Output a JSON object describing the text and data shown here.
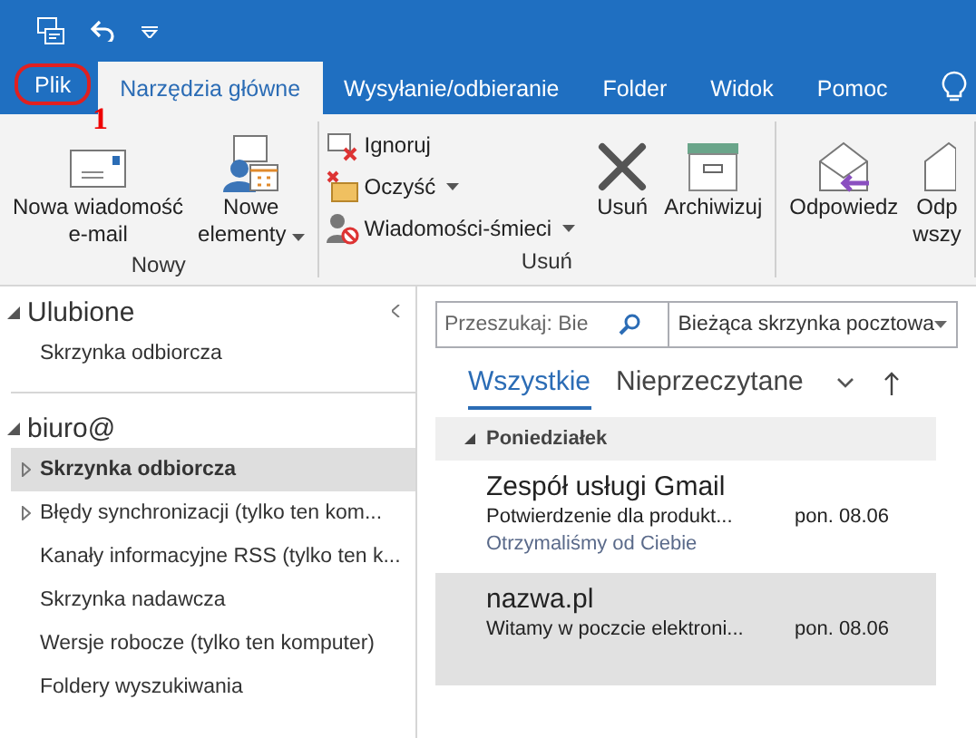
{
  "tabs": [
    {
      "label": "Plik",
      "selected": false,
      "kind": "file",
      "highlighted": true,
      "marker": "1"
    },
    {
      "label": "Narzędzia główne",
      "selected": true,
      "kind": "tab"
    },
    {
      "label": "Wysyłanie/odbieranie",
      "selected": false,
      "kind": "tab"
    },
    {
      "label": "Folder",
      "selected": false,
      "kind": "tab"
    },
    {
      "label": "Widok",
      "selected": false,
      "kind": "tab"
    },
    {
      "label": "Pomoc",
      "selected": false,
      "kind": "tab"
    }
  ],
  "ribbon": {
    "groups": [
      {
        "label": "Nowy",
        "buttons": [
          {
            "kind": "large",
            "lines": [
              "Nowa wiadomość",
              "e-mail"
            ],
            "dropdown": false
          },
          {
            "kind": "large",
            "lines": [
              "Nowe",
              "elementy"
            ],
            "dropdown": true
          }
        ]
      },
      {
        "label": "Usuń",
        "buttons": [
          {
            "kind": "small",
            "lines": [
              "Ignoruj"
            ],
            "dropdown": false
          },
          {
            "kind": "small",
            "lines": [
              "Oczyść"
            ],
            "dropdown": true
          },
          {
            "kind": "small",
            "lines": [
              "Wiadomości-śmieci"
            ],
            "dropdown": true
          },
          {
            "kind": "large",
            "lines": [
              "Usuń"
            ],
            "dropdown": false
          },
          {
            "kind": "large",
            "lines": [
              "Archiwizuj"
            ],
            "dropdown": false
          }
        ]
      },
      {
        "buttons": [
          {
            "kind": "large",
            "lines": [
              "Odpowiedz"
            ],
            "dropdown": false
          },
          {
            "kind": "large",
            "lines": [
              "Odp",
              "wszy"
            ],
            "dropdown": false
          }
        ]
      }
    ]
  },
  "folders": [
    {
      "title": "Ulubione",
      "expanded": true,
      "items": [
        {
          "label": "Skrzynka odbiorcza",
          "selected": false,
          "has_children": false
        }
      ]
    },
    {
      "title": "biuro@",
      "expanded": true,
      "items": [
        {
          "label": "Skrzynka odbiorcza",
          "selected": true,
          "has_children": true
        },
        {
          "label": "Błędy synchronizacji (tylko ten kom...",
          "selected": false,
          "has_children": true
        },
        {
          "label": "Kanały informacyjne RSS (tylko ten k...",
          "selected": false,
          "has_children": false
        },
        {
          "label": "Skrzynka nadawcza",
          "selected": false,
          "has_children": false
        },
        {
          "label": "Wersje robocze (tylko ten komputer)",
          "selected": false,
          "has_children": false
        },
        {
          "label": "Foldery wyszukiwania",
          "selected": false,
          "has_children": false
        }
      ]
    }
  ],
  "search": {
    "placeholder": "Przeszukaj: Bie",
    "scope": "Bieżąca skrzynka pocztowa"
  },
  "filters": [
    {
      "label": "Wszystkie",
      "selected": true
    },
    {
      "label": "Nieprzeczytane",
      "selected": false
    }
  ],
  "message_groups": [
    {
      "title": "Poniedziałek",
      "expanded": true,
      "messages": [
        {
          "sender": "Zespół usługi Gmail",
          "subject": "Potwierdzenie dla produkt...",
          "date": "pon. 08.06",
          "preview": "Otrzymaliśmy od Ciebie",
          "selected": false
        },
        {
          "sender": "nazwa.pl",
          "subject": "Witamy w poczcie elektroni...",
          "date": "pon. 08.06",
          "selected": true
        }
      ]
    }
  ]
}
